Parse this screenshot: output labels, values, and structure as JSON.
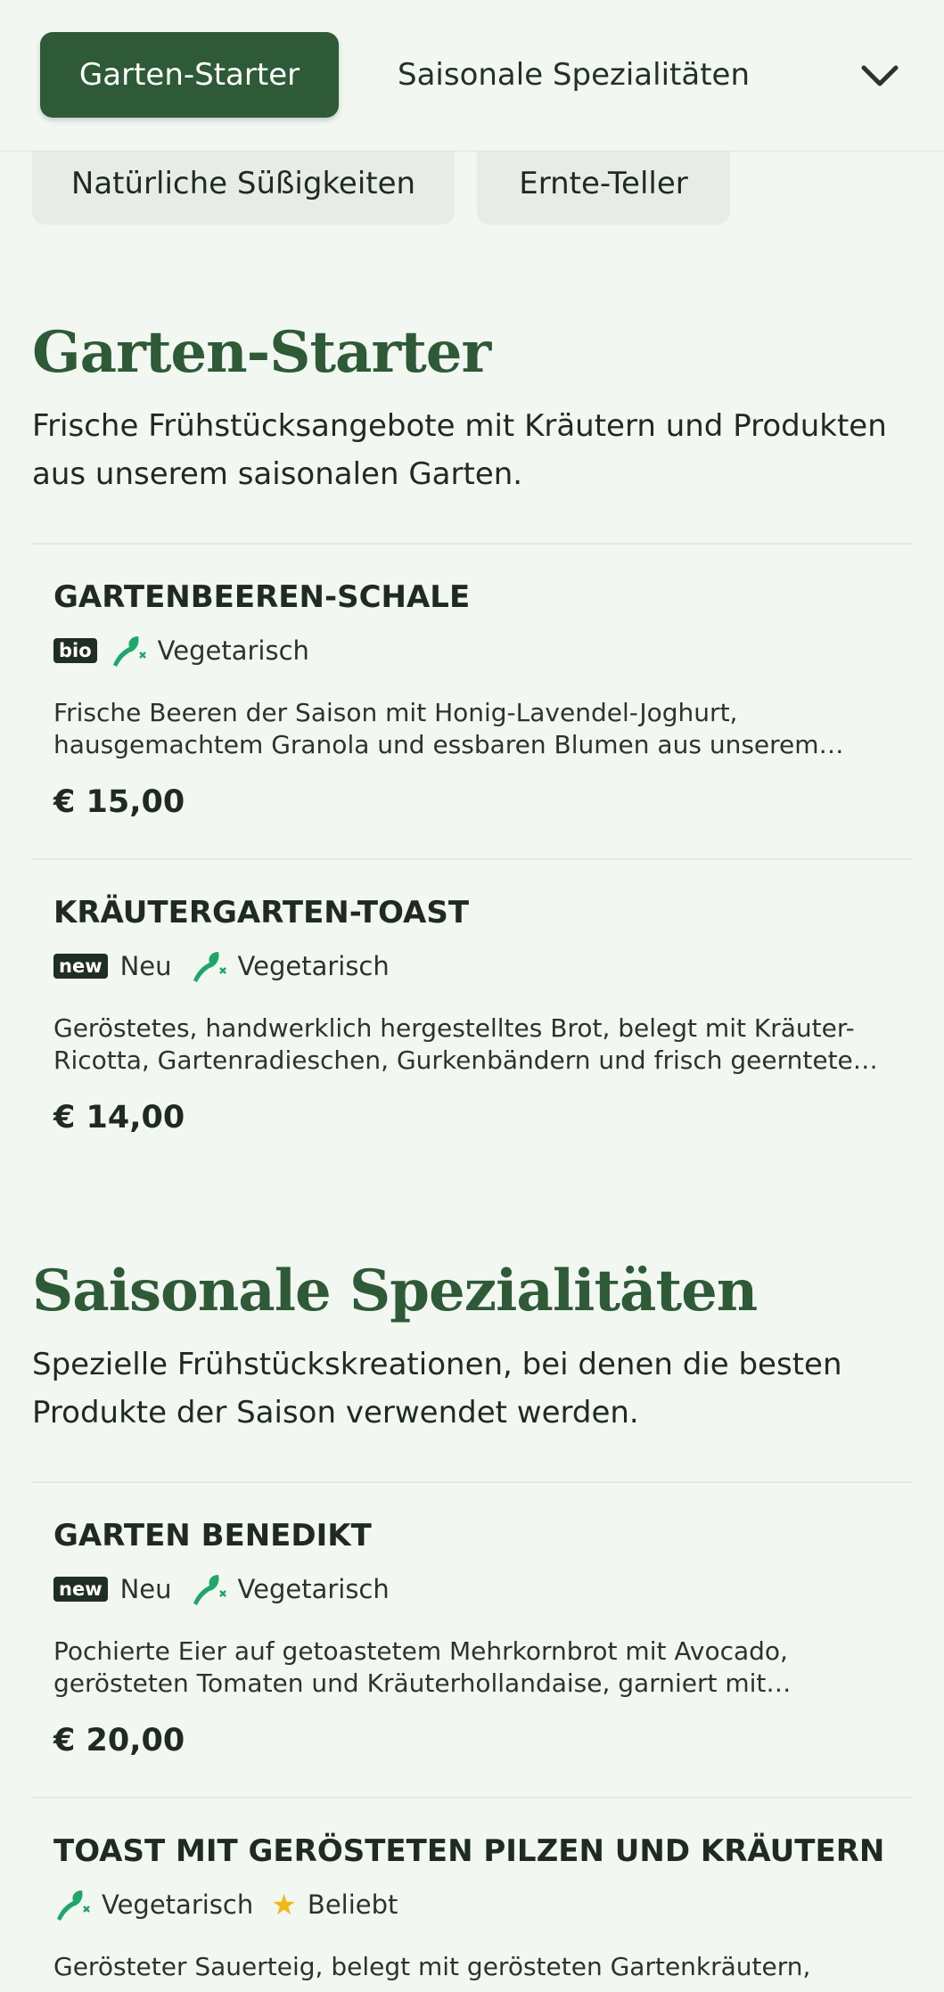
{
  "nav": {
    "active_tab": "Garten-Starter",
    "tab2": "Saisonale Spezialitäten",
    "chips": [
      "Natürliche Süßigkeiten",
      "Ernte-Teller"
    ],
    "expand_icon": "chevron-down-icon"
  },
  "sections": [
    {
      "title": "Garten-Starter",
      "description": "Frische Frühstücksangebote mit Kräutern und Produkten aus unserem saisonalen Garten.",
      "items": [
        {
          "name": "GARTENBEEREN-SCHALE",
          "badge": "bio",
          "tags": [
            "Vegetarisch"
          ],
          "description": "Frische Beeren der Saison mit Honig-Lavendel-Joghurt, hausgemachtem Granola und essbaren Blumen aus unserem…",
          "price": "€ 15,00"
        },
        {
          "name": "KRÄUTERGARTEN-TOAST",
          "badge": "new",
          "badge_text": "Neu",
          "tags": [
            "Vegetarisch"
          ],
          "description": "Geröstetes, handwerklich hergestelltes Brot, belegt mit Kräuter-Ricotta, Gartenradieschen, Gurkenbändern und frisch geerntete…",
          "price": "€ 14,00"
        }
      ]
    },
    {
      "title": "Saisonale Spezialitäten",
      "description": "Spezielle Frühstückskreationen, bei denen die besten Produkte der Saison verwendet werden.",
      "items": [
        {
          "name": "GARTEN BENEDIKT",
          "badge": "new",
          "badge_text": "Neu",
          "tags": [
            "Vegetarisch"
          ],
          "description": "Pochierte Eier auf getoastetem Mehrkornbrot mit Avocado, gerösteten Tomaten und Kräuterhollandaise, garniert mit…",
          "price": "€ 20,00"
        },
        {
          "name": "TOAST MIT GERÖSTETEN PILZEN UND KRÄUTERN",
          "tags": [
            "Vegetarisch",
            "Beliebt"
          ],
          "description": "Gerösteter Sauerteig, belegt mit gerösteten Gartenkräutern,"
        }
      ]
    }
  ],
  "colors": {
    "accent": "#2e5a37",
    "leaf": "#1fa66a",
    "star": "#f1b714",
    "background": "#f2f7f1"
  }
}
